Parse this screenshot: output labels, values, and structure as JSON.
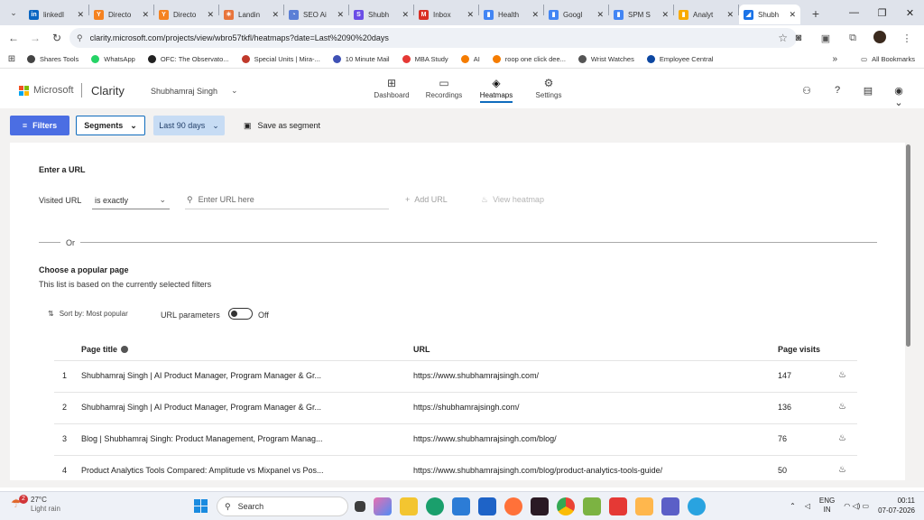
{
  "browser": {
    "tabs": [
      {
        "title": "linkedI",
        "color": "#0a66c2",
        "glyph": "in"
      },
      {
        "title": "Directo",
        "color": "#f58220",
        "glyph": "Y"
      },
      {
        "title": "Directo",
        "color": "#f58220",
        "glyph": "Y"
      },
      {
        "title": "Landin",
        "color": "#e8743b",
        "glyph": "✳"
      },
      {
        "title": "SEO Ai",
        "color": "#5b7fd6",
        "glyph": "◔"
      },
      {
        "title": "Shubh",
        "color": "#6b4de6",
        "glyph": "S"
      },
      {
        "title": "Inbox",
        "color": "#d93025",
        "glyph": "M"
      },
      {
        "title": "Health",
        "color": "#4285f4",
        "glyph": "▮"
      },
      {
        "title": "Googl",
        "color": "#4285f4",
        "glyph": "▮"
      },
      {
        "title": "SPM S",
        "color": "#4285f4",
        "glyph": "▮"
      },
      {
        "title": "Analyt",
        "color": "#f9ab00",
        "glyph": "▮"
      },
      {
        "title": "Shubh",
        "color": "#1a73e8",
        "glyph": "◢",
        "active": true
      }
    ],
    "address": "clarity.microsoft.com/projects/view/wbro57tkfl/heatmaps?date=Last%2090%20days",
    "bookmarks": [
      {
        "label": "Shares Tools",
        "color": "#444"
      },
      {
        "label": "WhatsApp",
        "color": "#25d366"
      },
      {
        "label": "OFC: The Observato...",
        "color": "#222"
      },
      {
        "label": "Special Units | Mira-...",
        "color": "#c0392b"
      },
      {
        "label": "10 Minute Mail",
        "color": "#3f51b5"
      },
      {
        "label": "MBA Study",
        "color": "#e53935"
      },
      {
        "label": "AI",
        "color": "#f57c00"
      },
      {
        "label": "roop one click dee...",
        "color": "#f57c00"
      },
      {
        "label": "Wrist Watches",
        "color": "#555"
      },
      {
        "label": "Employee Central",
        "color": "#0d47a1"
      }
    ],
    "all_bookmarks": "All Bookmarks"
  },
  "header": {
    "brand": "Microsoft",
    "product": "Clarity",
    "project": "Shubhamraj Singh",
    "nav": [
      {
        "label": "Dashboard",
        "icon": "⊞"
      },
      {
        "label": "Recordings",
        "icon": "▭"
      },
      {
        "label": "Heatmaps",
        "icon": "◈",
        "active": true
      },
      {
        "label": "Settings",
        "icon": "⚙"
      }
    ]
  },
  "toolbar": {
    "filters": "Filters",
    "segments": "Segments",
    "date_range": "Last 90 days",
    "save_segment": "Save as segment"
  },
  "url_section": {
    "heading": "Enter a URL",
    "visited_label": "Visited URL",
    "match_type": "is exactly",
    "url_placeholder": "Enter URL here",
    "add_url": "Add URL",
    "view_heatmap": "View heatmap",
    "or": "Or"
  },
  "popular": {
    "heading": "Choose a popular page",
    "subheading": "This list is based on the currently selected filters",
    "sort": "Sort by: Most popular",
    "url_params_label": "URL parameters",
    "url_params_state": "Off",
    "columns": {
      "title": "Page title",
      "url": "URL",
      "visits": "Page visits"
    },
    "rows": [
      {
        "idx": "1",
        "title": "Shubhamraj Singh | AI Product Manager, Program Manager & Gr...",
        "url": "https://www.shubhamrajsingh.com/",
        "visits": "147"
      },
      {
        "idx": "2",
        "title": "Shubhamraj Singh | AI Product Manager, Program Manager & Gr...",
        "url": "https://shubhamrajsingh.com/",
        "visits": "136"
      },
      {
        "idx": "3",
        "title": "Blog | Shubhamraj Singh: Product Management, Program Manag...",
        "url": "https://www.shubhamrajsingh.com/blog/",
        "visits": "76"
      },
      {
        "idx": "4",
        "title": "Product Analytics Tools Compared: Amplitude vs Mixpanel vs Pos...",
        "url": "https://www.shubhamrajsingh.com/blog/product-analytics-tools-guide/",
        "visits": "50"
      }
    ]
  },
  "taskbar": {
    "temperature": "27°C",
    "weather": "Light rain",
    "weather_badge": "2",
    "search": "Search",
    "lang1": "ENG",
    "lang2": "IN",
    "time": "00:11",
    "date": "07-07-2026"
  }
}
